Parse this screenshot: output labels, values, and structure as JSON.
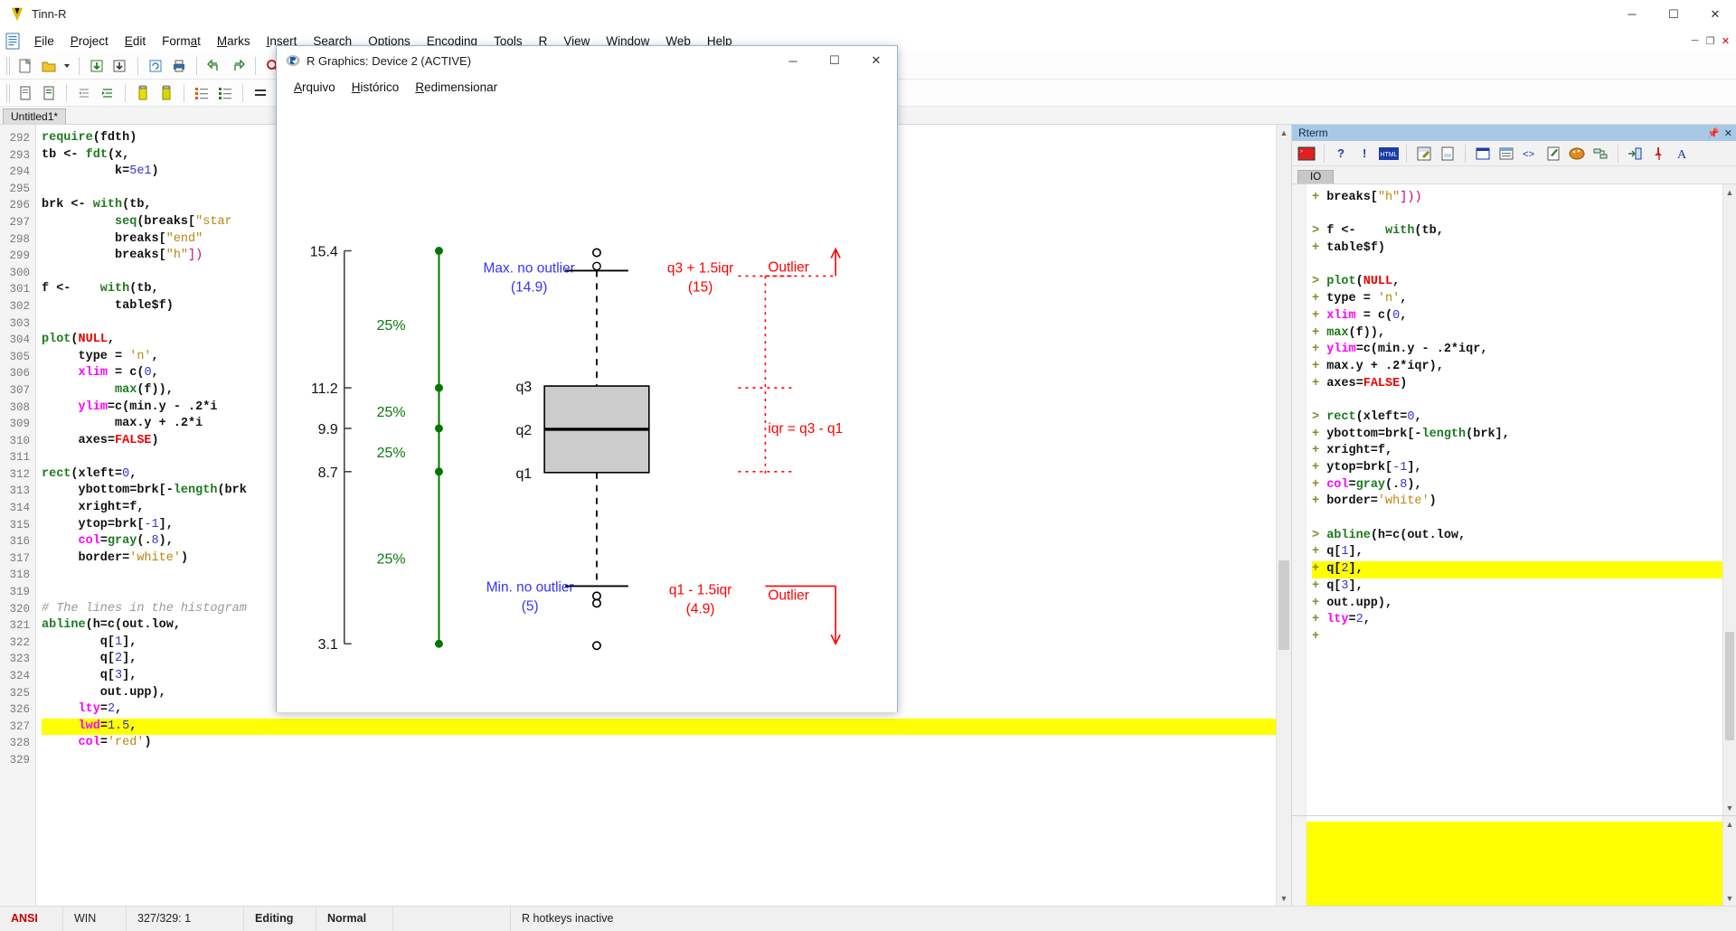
{
  "window": {
    "title": "Tinn-R",
    "app_icon": "tinnr-logo-icon",
    "minimize": "─",
    "maximize": "☐",
    "close": "✕"
  },
  "menubar": {
    "items": [
      {
        "label": "File",
        "accel": "F"
      },
      {
        "label": "Project",
        "accel": "P"
      },
      {
        "label": "Edit",
        "accel": "E"
      },
      {
        "label": "Format",
        "accel": "a"
      },
      {
        "label": "Marks",
        "accel": "M"
      },
      {
        "label": "Insert",
        "accel": "I"
      },
      {
        "label": "Search",
        "accel": "S"
      },
      {
        "label": "Options",
        "accel": "O"
      },
      {
        "label": "Encoding",
        "accel": "d"
      },
      {
        "label": "Tools",
        "accel": "T"
      },
      {
        "label": "R",
        "accel": "R"
      },
      {
        "label": "View",
        "accel": "V"
      },
      {
        "label": "Window",
        "accel": "W"
      },
      {
        "label": "Web",
        "accel": "b"
      },
      {
        "label": "Help",
        "accel": "H"
      }
    ],
    "mini_buttons": [
      "─",
      "❐",
      "✕"
    ]
  },
  "tabs": {
    "document_tab": "Untitled1*"
  },
  "editor": {
    "first_line": 292,
    "highlight_line": 327,
    "lines": [
      {
        "n": 292,
        "tokens": [
          {
            "t": "require",
            "c": "fun"
          },
          {
            "t": "(fdth)",
            "c": "txt"
          }
        ]
      },
      {
        "n": 293,
        "tokens": [
          {
            "t": "tb ",
            "c": "txt"
          },
          {
            "t": "<- ",
            "c": "op"
          },
          {
            "t": "fdt",
            "c": "fun"
          },
          {
            "t": "(x,",
            "c": "txt"
          }
        ]
      },
      {
        "n": 294,
        "tokens": [
          {
            "t": "          k=",
            "c": "txt"
          },
          {
            "t": "5e1",
            "c": "num"
          },
          {
            "t": ")",
            "c": "txt"
          }
        ]
      },
      {
        "n": 295,
        "tokens": []
      },
      {
        "n": 296,
        "tokens": [
          {
            "t": "brk ",
            "c": "txt"
          },
          {
            "t": "<- ",
            "c": "op"
          },
          {
            "t": "with",
            "c": "fun"
          },
          {
            "t": "(tb,",
            "c": "txt"
          }
        ]
      },
      {
        "n": 297,
        "tokens": [
          {
            "t": "          seq",
            "c": "fun"
          },
          {
            "t": "(breaks[",
            "c": "txt"
          },
          {
            "t": "\"star",
            "c": "str"
          }
        ]
      },
      {
        "n": 298,
        "tokens": [
          {
            "t": "          breaks[",
            "c": "txt"
          },
          {
            "t": "\"end\"",
            "c": "str"
          }
        ]
      },
      {
        "n": 299,
        "tokens": [
          {
            "t": "          breaks[",
            "c": "txt"
          },
          {
            "t": "\"h\"",
            "c": "str"
          },
          {
            "t": "])",
            "c": "brk"
          }
        ]
      },
      {
        "n": 300,
        "tokens": []
      },
      {
        "n": 301,
        "tokens": [
          {
            "t": "f ",
            "c": "txt"
          },
          {
            "t": "<-  ",
            "c": "op"
          },
          {
            "t": "  with",
            "c": "fun"
          },
          {
            "t": "(tb,",
            "c": "txt"
          }
        ]
      },
      {
        "n": 302,
        "tokens": [
          {
            "t": "          table$f)",
            "c": "txt"
          }
        ]
      },
      {
        "n": 303,
        "tokens": []
      },
      {
        "n": 304,
        "tokens": [
          {
            "t": "plot",
            "c": "fun"
          },
          {
            "t": "(",
            "c": "txt"
          },
          {
            "t": "NULL",
            "c": "null"
          },
          {
            "t": ",",
            "c": "txt"
          }
        ]
      },
      {
        "n": 305,
        "tokens": [
          {
            "t": "     type = ",
            "c": "txt"
          },
          {
            "t": "'n'",
            "c": "str"
          },
          {
            "t": ",",
            "c": "txt"
          }
        ]
      },
      {
        "n": 306,
        "tokens": [
          {
            "t": "     ",
            "c": "txt"
          },
          {
            "t": "xlim",
            "c": "arg"
          },
          {
            "t": " = c(",
            "c": "txt"
          },
          {
            "t": "0",
            "c": "num"
          },
          {
            "t": ",",
            "c": "txt"
          }
        ]
      },
      {
        "n": 307,
        "tokens": [
          {
            "t": "          max",
            "c": "fun"
          },
          {
            "t": "(f)),",
            "c": "txt"
          }
        ]
      },
      {
        "n": 308,
        "tokens": [
          {
            "t": "     ",
            "c": "txt"
          },
          {
            "t": "ylim",
            "c": "arg"
          },
          {
            "t": "=c(min.y - .2*i",
            "c": "txt"
          }
        ]
      },
      {
        "n": 309,
        "tokens": [
          {
            "t": "          max.y + .2*i",
            "c": "txt"
          }
        ]
      },
      {
        "n": 310,
        "tokens": [
          {
            "t": "     axes=",
            "c": "txt"
          },
          {
            "t": "FALSE",
            "c": "null"
          },
          {
            "t": ")",
            "c": "txt"
          }
        ]
      },
      {
        "n": 311,
        "tokens": []
      },
      {
        "n": 312,
        "tokens": [
          {
            "t": "rect",
            "c": "fun"
          },
          {
            "t": "(xleft=",
            "c": "txt"
          },
          {
            "t": "0",
            "c": "num"
          },
          {
            "t": ",",
            "c": "txt"
          }
        ]
      },
      {
        "n": 313,
        "tokens": [
          {
            "t": "     ybottom=brk[-",
            "c": "txt"
          },
          {
            "t": "length",
            "c": "fun"
          },
          {
            "t": "(brk",
            "c": "txt"
          }
        ]
      },
      {
        "n": 314,
        "tokens": [
          {
            "t": "     xright=f,",
            "c": "txt"
          }
        ]
      },
      {
        "n": 315,
        "tokens": [
          {
            "t": "     ytop=brk[",
            "c": "txt"
          },
          {
            "t": "-1",
            "c": "num"
          },
          {
            "t": "],",
            "c": "txt"
          }
        ]
      },
      {
        "n": 316,
        "tokens": [
          {
            "t": "     ",
            "c": "txt"
          },
          {
            "t": "col",
            "c": "arg"
          },
          {
            "t": "=",
            "c": "txt"
          },
          {
            "t": "gray",
            "c": "fun"
          },
          {
            "t": "(.",
            "c": "txt"
          },
          {
            "t": "8",
            "c": "num"
          },
          {
            "t": "),",
            "c": "txt"
          }
        ]
      },
      {
        "n": 317,
        "tokens": [
          {
            "t": "     border=",
            "c": "txt"
          },
          {
            "t": "'white'",
            "c": "str"
          },
          {
            "t": ")",
            "c": "txt"
          }
        ]
      },
      {
        "n": 318,
        "tokens": []
      },
      {
        "n": 319,
        "tokens": []
      },
      {
        "n": 320,
        "tokens": [
          {
            "t": "# The lines in the histogram",
            "c": "com"
          }
        ]
      },
      {
        "n": 321,
        "tokens": [
          {
            "t": "abline",
            "c": "fun"
          },
          {
            "t": "(h=c(out.low,",
            "c": "txt"
          }
        ]
      },
      {
        "n": 322,
        "tokens": [
          {
            "t": "        q[",
            "c": "txt"
          },
          {
            "t": "1",
            "c": "num"
          },
          {
            "t": "],",
            "c": "txt"
          }
        ]
      },
      {
        "n": 323,
        "tokens": [
          {
            "t": "        q[",
            "c": "txt"
          },
          {
            "t": "2",
            "c": "num"
          },
          {
            "t": "],",
            "c": "txt"
          }
        ]
      },
      {
        "n": 324,
        "tokens": [
          {
            "t": "        q[",
            "c": "txt"
          },
          {
            "t": "3",
            "c": "num"
          },
          {
            "t": "],",
            "c": "txt"
          }
        ]
      },
      {
        "n": 325,
        "tokens": [
          {
            "t": "        out.upp),",
            "c": "txt"
          }
        ]
      },
      {
        "n": 326,
        "tokens": [
          {
            "t": "     ",
            "c": "txt"
          },
          {
            "t": "lty",
            "c": "arg"
          },
          {
            "t": "=",
            "c": "txt"
          },
          {
            "t": "2",
            "c": "num"
          },
          {
            "t": ",",
            "c": "txt"
          }
        ]
      },
      {
        "n": 327,
        "tokens": [
          {
            "t": "     ",
            "c": "txt"
          },
          {
            "t": "lwd",
            "c": "arg"
          },
          {
            "t": "=",
            "c": "txt"
          },
          {
            "t": "1.5",
            "c": "num"
          },
          {
            "t": ",",
            "c": "txt"
          }
        ]
      },
      {
        "n": 328,
        "tokens": [
          {
            "t": "     ",
            "c": "txt"
          },
          {
            "t": "col",
            "c": "arg"
          },
          {
            "t": "=",
            "c": "txt"
          },
          {
            "t": "'red'",
            "c": "str"
          },
          {
            "t": ")",
            "c": "txt"
          }
        ]
      },
      {
        "n": 329,
        "tokens": []
      }
    ]
  },
  "rterm": {
    "caption": "Rterm",
    "pin_icon": "pin-icon",
    "close_icon": "close-icon",
    "tab": "IO",
    "highlight_line_index": 22,
    "lines": [
      [
        {
          "t": "+ ",
          "c": "pr"
        },
        {
          "t": "breaks[",
          "c": "txt"
        },
        {
          "t": "\"h\"",
          "c": "str"
        },
        {
          "t": "])",
          "c": "brk"
        },
        {
          "t": ")",
          "c": "brk"
        }
      ],
      [],
      [
        {
          "t": "> ",
          "c": "pr"
        },
        {
          "t": "f ",
          "c": "txt"
        },
        {
          "t": "<-  ",
          "c": "op"
        },
        {
          "t": "  with",
          "c": "fun"
        },
        {
          "t": "(tb,",
          "c": "txt"
        }
      ],
      [
        {
          "t": "+ ",
          "c": "pr"
        },
        {
          "t": "table$f)",
          "c": "txt"
        }
      ],
      [],
      [
        {
          "t": "> ",
          "c": "pr"
        },
        {
          "t": "plot",
          "c": "fun"
        },
        {
          "t": "(",
          "c": "txt"
        },
        {
          "t": "NULL",
          "c": "null"
        },
        {
          "t": ",",
          "c": "txt"
        }
      ],
      [
        {
          "t": "+ ",
          "c": "pr"
        },
        {
          "t": "type = ",
          "c": "txt"
        },
        {
          "t": "'n'",
          "c": "str"
        },
        {
          "t": ",",
          "c": "txt"
        }
      ],
      [
        {
          "t": "+ ",
          "c": "pr"
        },
        {
          "t": "xlim",
          "c": "arg"
        },
        {
          "t": " = c(",
          "c": "txt"
        },
        {
          "t": "0",
          "c": "num"
        },
        {
          "t": ",",
          "c": "txt"
        }
      ],
      [
        {
          "t": "+ ",
          "c": "pr"
        },
        {
          "t": "max",
          "c": "fun"
        },
        {
          "t": "(f)),",
          "c": "txt"
        }
      ],
      [
        {
          "t": "+ ",
          "c": "pr"
        },
        {
          "t": "ylim",
          "c": "arg"
        },
        {
          "t": "=c(min.y - .2*iqr,",
          "c": "txt"
        }
      ],
      [
        {
          "t": "+ ",
          "c": "pr"
        },
        {
          "t": "max.y + .2*iqr),",
          "c": "txt"
        }
      ],
      [
        {
          "t": "+ ",
          "c": "pr"
        },
        {
          "t": "axes=",
          "c": "txt"
        },
        {
          "t": "FALSE",
          "c": "null"
        },
        {
          "t": ")",
          "c": "txt"
        }
      ],
      [],
      [
        {
          "t": "> ",
          "c": "pr"
        },
        {
          "t": "rect",
          "c": "fun"
        },
        {
          "t": "(xleft=",
          "c": "txt"
        },
        {
          "t": "0",
          "c": "num"
        },
        {
          "t": ",",
          "c": "txt"
        }
      ],
      [
        {
          "t": "+ ",
          "c": "pr"
        },
        {
          "t": "ybottom=brk[-",
          "c": "txt"
        },
        {
          "t": "length",
          "c": "fun"
        },
        {
          "t": "(brk",
          "c": "txt"
        },
        {
          "t": "],",
          "c": "txt"
        }
      ],
      [
        {
          "t": "+ ",
          "c": "pr"
        },
        {
          "t": "xright=f,",
          "c": "txt"
        }
      ],
      [
        {
          "t": "+ ",
          "c": "pr"
        },
        {
          "t": "ytop=brk[",
          "c": "txt"
        },
        {
          "t": "-1",
          "c": "num"
        },
        {
          "t": "],",
          "c": "txt"
        }
      ],
      [
        {
          "t": "+ ",
          "c": "pr"
        },
        {
          "t": "col",
          "c": "arg"
        },
        {
          "t": "=",
          "c": "txt"
        },
        {
          "t": "gray",
          "c": "fun"
        },
        {
          "t": "(.",
          "c": "txt"
        },
        {
          "t": "8",
          "c": "num"
        },
        {
          "t": "),",
          "c": "txt"
        }
      ],
      [
        {
          "t": "+ ",
          "c": "pr"
        },
        {
          "t": "border=",
          "c": "txt"
        },
        {
          "t": "'white'",
          "c": "str"
        },
        {
          "t": ")",
          "c": "txt"
        }
      ],
      [],
      [
        {
          "t": "> ",
          "c": "pr"
        },
        {
          "t": "abline",
          "c": "fun"
        },
        {
          "t": "(h=c(out.low,",
          "c": "txt"
        }
      ],
      [
        {
          "t": "+ ",
          "c": "pr"
        },
        {
          "t": "q[",
          "c": "txt"
        },
        {
          "t": "1",
          "c": "num"
        },
        {
          "t": "],",
          "c": "txt"
        }
      ],
      [
        {
          "t": "+ ",
          "c": "pr"
        },
        {
          "t": "q[",
          "c": "txt"
        },
        {
          "t": "2",
          "c": "num"
        },
        {
          "t": "],",
          "c": "txt"
        }
      ],
      [
        {
          "t": "+ ",
          "c": "pr"
        },
        {
          "t": "q[",
          "c": "txt"
        },
        {
          "t": "3",
          "c": "num"
        },
        {
          "t": "],",
          "c": "txt"
        }
      ],
      [
        {
          "t": "+ ",
          "c": "pr"
        },
        {
          "t": "out.upp),",
          "c": "txt"
        }
      ],
      [
        {
          "t": "+ ",
          "c": "pr"
        },
        {
          "t": "lty",
          "c": "arg"
        },
        {
          "t": "=",
          "c": "txt"
        },
        {
          "t": "2",
          "c": "num"
        },
        {
          "t": ",",
          "c": "txt"
        }
      ],
      [
        {
          "t": "+ ",
          "c": "pr"
        }
      ]
    ]
  },
  "statusbar": {
    "encoding": "ANSI",
    "eol": "WIN",
    "position": "327/329: 1",
    "mode": "Editing",
    "insert": "Normal",
    "hotkeys": "R hotkeys inactive"
  },
  "graphics_window": {
    "title": "R Graphics: Device 2 (ACTIVE)",
    "icon": "r-logo-icon",
    "minimize": "─",
    "maximize": "☐",
    "close": "✕",
    "menu": [
      {
        "label": "Arquivo",
        "accel": "A"
      },
      {
        "label": "Histórico",
        "accel": "H"
      },
      {
        "label": "Redimensionar",
        "accel": "R"
      }
    ]
  },
  "chart_data": {
    "type": "box",
    "title": "",
    "xlabel": "",
    "ylabel": "",
    "axis_ticks": [
      {
        "label": "15.4",
        "value": 15.4
      },
      {
        "label": "11.2",
        "value": 11.2
      },
      {
        "label": "9.9",
        "value": 9.9
      },
      {
        "label": "8.7",
        "value": 8.7
      },
      {
        "label": "3.1",
        "value": 3.1
      }
    ],
    "quartile_segment_labels": [
      "25%",
      "25%",
      "25%",
      "25%"
    ],
    "box": {
      "q1": 8.7,
      "q2_median": 9.9,
      "q3": 11.2,
      "min_no_outlier": 5,
      "max_no_outlier": 14.9,
      "q1_label": "q1",
      "q2_label": "q2",
      "q3_label": "q3"
    },
    "annotations_blue": [
      {
        "text": "Max. no outlier",
        "value": "(14.9)"
      },
      {
        "text": "Min. no outlier",
        "value": "(5)"
      }
    ],
    "annotations_red": [
      {
        "text": "q3 + 1.5iqr",
        "value": "(15)"
      },
      {
        "text": "q1 - 1.5iqr",
        "value": "(4.9)"
      },
      {
        "text": "Outlier"
      },
      {
        "text": "Outlier"
      },
      {
        "text": "iqr = q3 - q1"
      }
    ],
    "colors": {
      "quartile_marker": "#007700",
      "blue_annotation": "#3333ff",
      "red_annotation": "#ff0000",
      "box_fill": "#cccccc",
      "box_border": "#000000"
    },
    "outliers_upper": 2,
    "outliers_lower": 3
  }
}
